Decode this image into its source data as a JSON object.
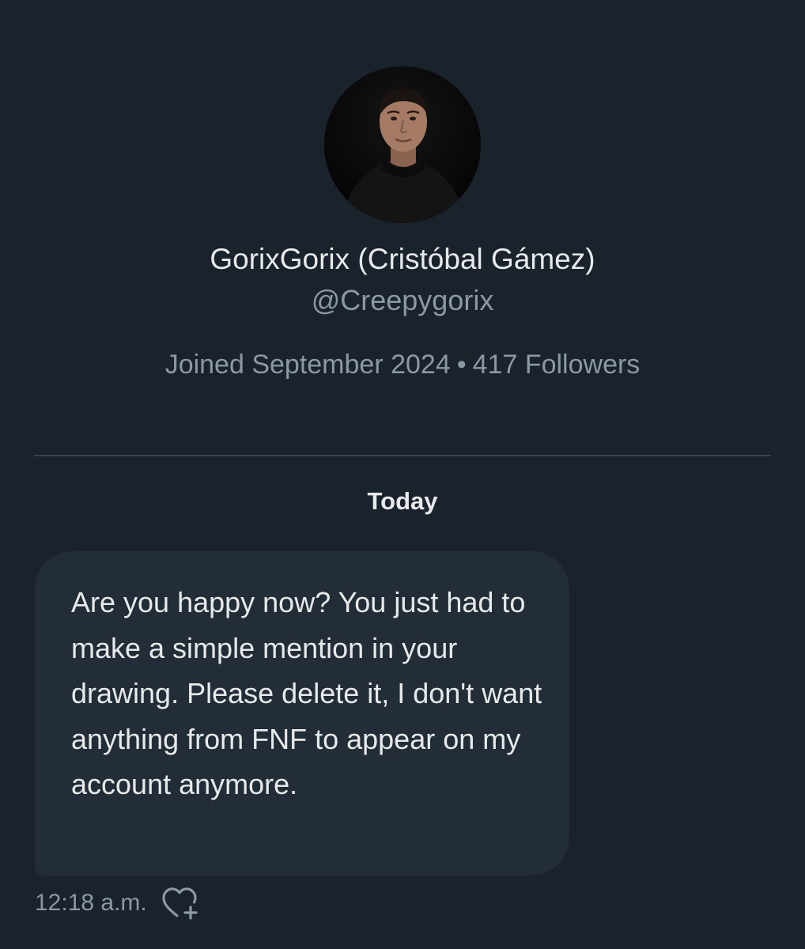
{
  "profile": {
    "display_name": "GorixGorix (Cristóbal Gámez)",
    "handle": "@Creepygorix",
    "joined": "Joined September 2024",
    "separator": "•",
    "followers": "417 Followers"
  },
  "conversation": {
    "day_label": "Today",
    "messages": [
      {
        "text": "Are you happy now? You just had to make a simple mention in your drawing. Please delete it, I don't want anything from FNF to appear on my account anymore.",
        "time": "12:18 a.m."
      }
    ]
  },
  "icons": {
    "avatar": "profile-photo",
    "react": "add-reaction-heart-icon"
  },
  "colors": {
    "background": "#1a222c",
    "bubble": "#222d37",
    "primary_text": "#e7e9ea",
    "secondary_text": "#8b98a5",
    "divider": "#38444d"
  }
}
